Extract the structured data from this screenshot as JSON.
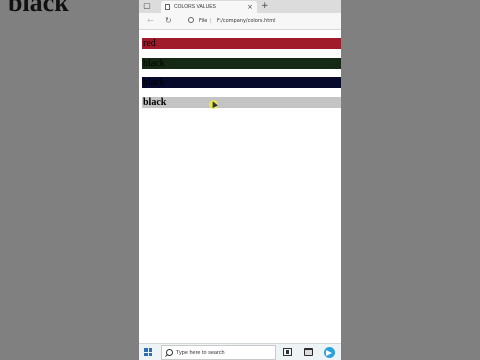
{
  "background_text": "black",
  "browser": {
    "tab_title": "COLORS VALUES",
    "close_glyph": "×",
    "newtab_glyph": "+",
    "back_glyph": "←",
    "reload_glyph": "↻",
    "address_label": "File",
    "address_sep": "|",
    "url": "F:/company/colors.html"
  },
  "page": {
    "bars": [
      {
        "text": "red",
        "color": "#a01c2a"
      },
      {
        "text": "black",
        "color": "#142a14"
      },
      {
        "text": "black",
        "color": "#080a2c"
      },
      {
        "text": "black",
        "color": "#c4c4c4"
      }
    ]
  },
  "taskbar": {
    "search_placeholder": "Type here to search",
    "icons": [
      "windows-logo-icon",
      "search-icon",
      "task-view-icon",
      "file-explorer-icon",
      "telegram-icon"
    ]
  }
}
